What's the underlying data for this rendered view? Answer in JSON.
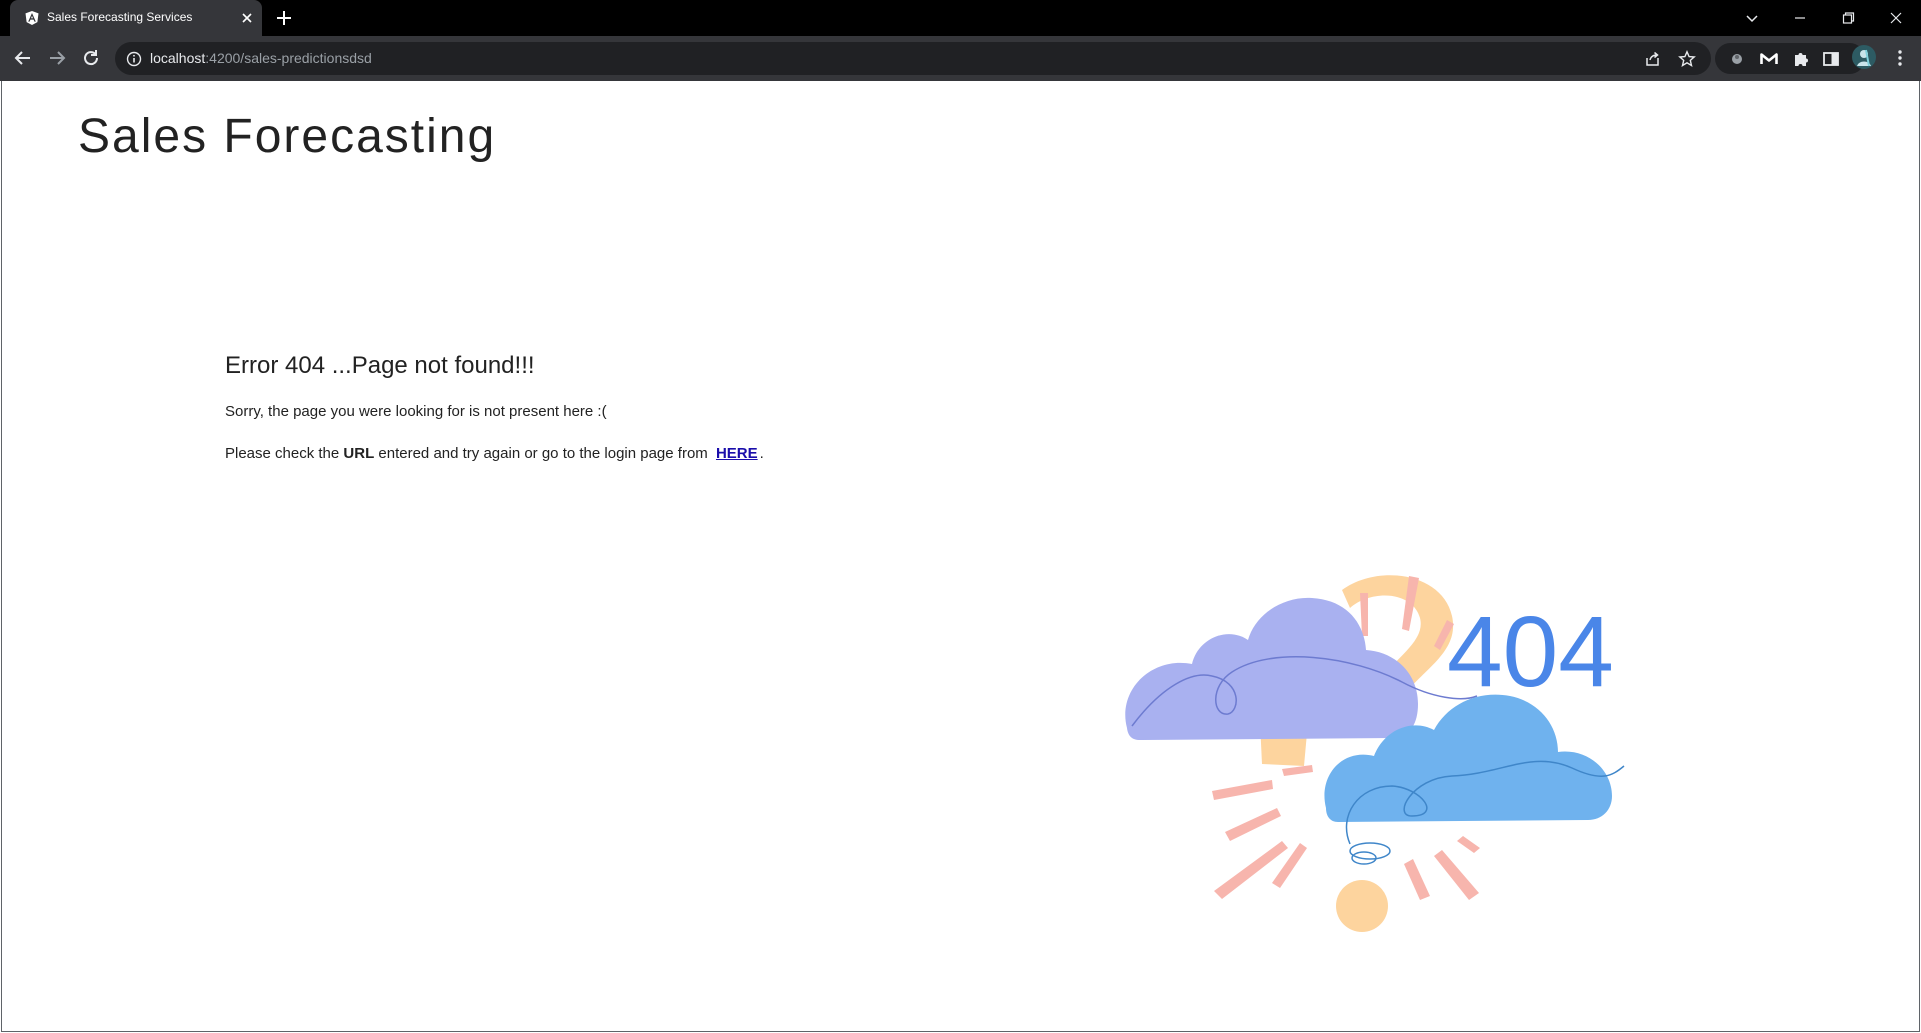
{
  "browser": {
    "tab": {
      "title": "Sales Forecasting Services"
    },
    "address_bar": {
      "host": "localhost",
      "path": ":4200/sales-predictionsdsd"
    },
    "colors": {
      "tabstrip": "#000000",
      "toolbar": "#35363a",
      "omnibox": "#202124"
    }
  },
  "page": {
    "app_title": "Sales Forecasting",
    "error": {
      "heading": "Error 404 ...Page not found!!!",
      "message": "Sorry, the page you were looking for is not present here :(",
      "help_prefix": "Please check the ",
      "help_bold": "URL",
      "help_middle": " entered and try again or go to the login page from ",
      "link_label": "HERE",
      "help_suffix": "."
    },
    "illustration": {
      "code_text": "404",
      "colors": {
        "code": "#4a86e8",
        "question_mark": "#fdd49e",
        "cloud_left": "#a9b1f0",
        "cloud_right": "#6fb2ee",
        "rays": "#f7b5ad"
      }
    }
  },
  "icons": {
    "tab_favicon": "angular-icon",
    "tab_close": "close-icon",
    "new_tab": "plus-icon",
    "back": "back-arrow-icon",
    "forward": "forward-arrow-icon",
    "reload": "reload-icon",
    "site_info": "info-icon",
    "share": "share-icon",
    "bookmark": "star-icon",
    "extensions": "puzzle-icon",
    "side_panel": "side-panel-icon",
    "profile": "avatar-icon",
    "menu": "kebab-menu-icon"
  }
}
